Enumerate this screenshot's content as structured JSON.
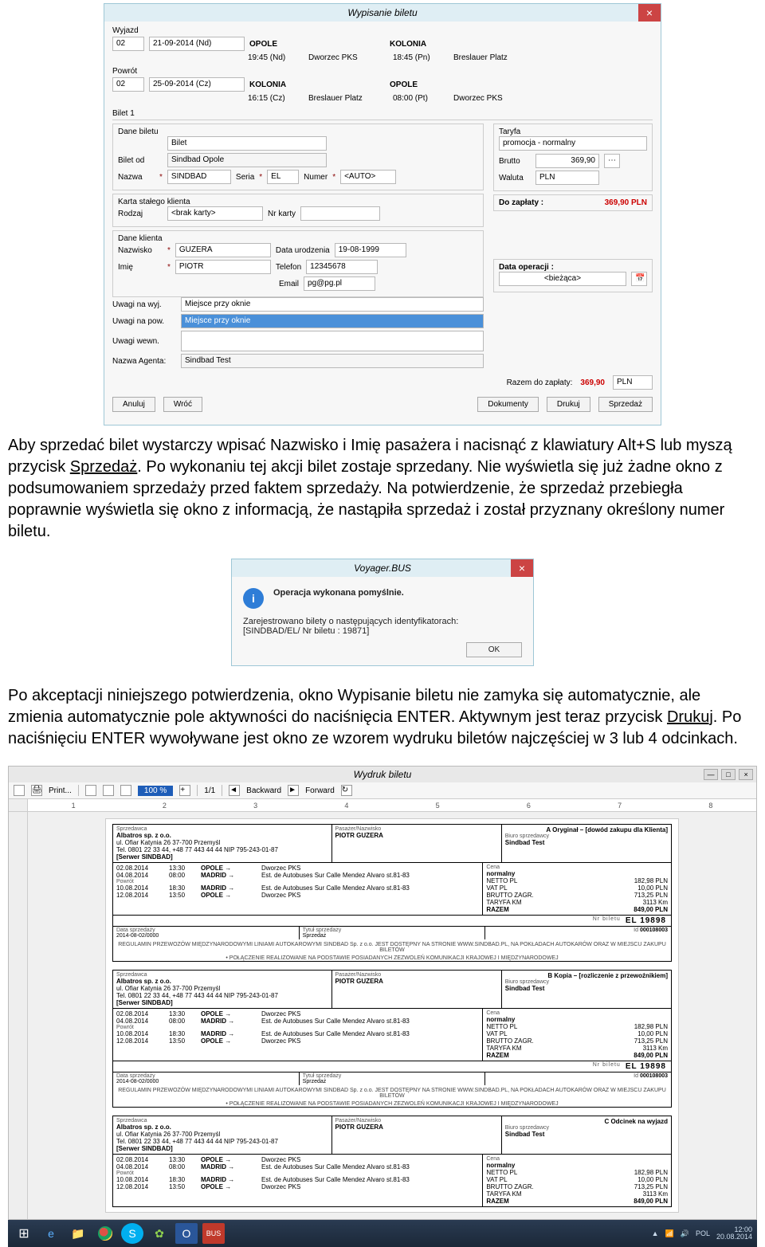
{
  "win1": {
    "title": "Wypisanie biletu",
    "wyjazd_label": "Wyjazd",
    "seg_no": "02",
    "out_date": "21-09-2014 (Nd)",
    "out_from": "OPOLE",
    "out_to": "KOLONIA",
    "out_time": "19:45 (Nd)",
    "out_station_from": "Dworzec PKS",
    "out_time2": "18:45 (Pn)",
    "out_station_to": "Breslauer Platz",
    "powrot_label": "Powrót",
    "ret_no": "02",
    "ret_date": "25-09-2014 (Cz)",
    "ret_from": "KOLONIA",
    "ret_to": "OPOLE",
    "ret_time": "16:15 (Cz)",
    "ret_station_from": "Breslauer Platz",
    "ret_time2": "08:00 (Pt)",
    "ret_station_to": "Dworzec PKS",
    "tab": "Bilet 1",
    "dane_biletu": "Dane biletu",
    "bilet_val": "Bilet",
    "biletod_label": "Bilet od",
    "biletod_val": "Sindbad Opole",
    "nazwa_label": "Nazwa",
    "nazwa_val": "SINDBAD",
    "seria_label": "Seria",
    "seria_val": "EL",
    "numer_label": "Numer",
    "numer_val": "<AUTO>",
    "taryfa_label": "Taryfa",
    "taryfa_val": "promocja - normalny",
    "brutto_label": "Brutto",
    "brutto_val": "369,90",
    "waluta_label": "Waluta",
    "waluta_val": "PLN",
    "dozaplaty_label": "Do zapłaty :",
    "dozaplaty_val": "369,90 PLN",
    "karta_label": "Karta stałego klienta",
    "rodzaj_label": "Rodzaj",
    "rodzaj_val": "<brak karty>",
    "nrkarty_label": "Nr karty",
    "daneklienta_label": "Dane klienta",
    "nazwisko_label": "Nazwisko",
    "nazwisko_val": "GUZERA",
    "dataur_label": "Data urodzenia",
    "dataur_val": "19-08-1999",
    "imie_label": "Imię",
    "imie_val": "PIOTR",
    "telefon_label": "Telefon",
    "telefon_val": "12345678",
    "email_label": "Email",
    "email_val": "pg@pg.pl",
    "dataop_label": "Data operacji :",
    "dataop_val": "<bieżąca>",
    "uwagi_wyj_label": "Uwagi na wyj.",
    "uwagi_wyj_val": "Miejsce przy oknie",
    "uwagi_pow_label": "Uwagi na pow.",
    "uwagi_pow_val": "Miejsce przy oknie",
    "uwagi_wewn_label": "Uwagi wewn.",
    "agent_label": "Nazwa Agenta:",
    "agent_val": "Sindbad Test",
    "razem_label": "Razem do zapłaty:",
    "razem_val": "369,90",
    "razem_cur": "PLN",
    "buttons": {
      "anuluj": "Anuluj",
      "wroc": "Wróć",
      "dokumenty": "Dokumenty",
      "drukuj": "Drukuj",
      "sprzedaz": "Sprzedaż"
    }
  },
  "para1": "Aby sprzedać bilet wystarczy wpisać Nazwisko i Imię pasażera i nacisnąć z klawiatury Alt+S lub myszą przycisk ",
  "para1_bold": "Sprzedaż",
  "para1b": ". Po wykonaniu tej akcji bilet zostaje sprzedany. Nie wyświetla się już żadne okno z podsumowaniem sprzedaży przed faktem sprzedaży. Na potwierdzenie, że sprzedaż przebiegła poprawnie wyświetla się okno z informacją, że nastąpiła sprzedaż i został przyznany określony numer biletu.",
  "dlg": {
    "title": "Voyager.BUS",
    "line1": "Operacja wykonana pomyślnie.",
    "line2": "Zarejestrowano bilety o następujących identyfikatorach:",
    "line3": "[SINDBAD/EL/ Nr biletu : 19871]",
    "ok": "OK"
  },
  "para2a": "Po akceptacji niniejszego potwierdzenia, okno Wypisanie biletu nie zamyka się automatycznie, ale zmienia automatycznie pole aktywności do naciśnięcia ENTER. Aktywnym jest teraz przycisk ",
  "para2_bold": "Drukuj",
  "para2b": ". Po naciśnięciu ENTER wywoływane jest okno ze wzorem wydruku biletów najczęściej w 3 lub 4 odcinkach.",
  "win3": {
    "title": "Wydruk biletu",
    "print": "Print...",
    "zoom": "100 %",
    "pages": "1/1",
    "backward": "Backward",
    "forward": "Forward",
    "rnums": [
      "1",
      "2",
      "3",
      "4",
      "5",
      "6",
      "7",
      "8"
    ],
    "tickets": [
      {
        "copy": "A Oryginał – [dowód zakupu dla Klienta]"
      },
      {
        "copy": "B Kopia – [rozliczenie z przewoźnikiem]"
      },
      {
        "copy": "C Odcinek na wyjazd"
      }
    ],
    "seller_hdr": "Sprzedawca",
    "seller1": "Albatros sp. z o.o.",
    "seller2": "ul. Ofiar Katynia 26 37-700 Przemyśl",
    "seller3": "Tel. 0801 22 33 44, +48 77 443 44 44 NIP 795-243-01-87",
    "seller4": "[Serwer SINDBAD]",
    "pass_hdr": "Pasażer/Nazwisko",
    "pass_name": "PIOTR GUZERA",
    "biuro_hdr": "Biuro sprzedawcy",
    "biuro_val": "Sindbad Test",
    "cena_hdr": "Cena",
    "cena_type": "normalny",
    "rows_labels": [
      "NETTO PL",
      "VAT PL",
      "BRUTTO ZAGR.",
      "TARYFA KM",
      "RAZEM"
    ],
    "rows_vals": [
      "182,98 PLN",
      "10,00 PLN",
      "713,25 PLN",
      "3113 Km",
      "849,00 PLN"
    ],
    "sched": [
      {
        "d": "02.08.2014",
        "t": "13:30",
        "c": "OPOLE →",
        "st": "Dworzec PKS"
      },
      {
        "d": "04.08.2014",
        "t": "08:00",
        "c": "MADRID →",
        "st": "Est. de Autobuses Sur Calle Mendez Alvaro st.81-83"
      },
      {
        "d": "",
        "t": "",
        "c": "",
        "st": ""
      },
      {
        "d": "10.08.2014",
        "t": "18:30",
        "c": "MADRID →",
        "st": "Est. de Autobuses Sur Calle Mendez Alvaro st.81-83"
      },
      {
        "d": "12.08.2014",
        "t": "13:50",
        "c": "OPOLE →",
        "st": "Dworzec PKS"
      }
    ],
    "powrot_pre": "Powrót",
    "nrbiletu_pre": "Nr biletu",
    "nrbiletu": "EL  19898",
    "datasp_lbl": "Data sprzedaży",
    "datasp_val": "2014-08-02/0000",
    "tyt_lbl": "Tytuł sprzedaży",
    "tyt_val": "Sprzedaż",
    "id_lbl": "Id",
    "id_val": "000108003",
    "regul": "REGULAMIN PRZEWOZÓW MIĘDZYNARODOWYMI LINIAMI AUTOKAROWYMI SINDBAD Sp. z o.o. JEST DOSTĘPNY NA STRONIE WWW.SINDBAD.PL, NA POKŁADACH AUTOKARÓW ORAZ W MIEJSCU ZAKUPU BILETÓW",
    "regul2": "• POŁĄCZENIE REALIZOWANE NA PODSTAWIE POSIADANYCH ZEZWOLEŃ KOMUNIKACJI KRAJOWEJ I MIĘDZYNARODOWEJ"
  },
  "tray": {
    "lang": "POL",
    "time": "12:00",
    "date": "20.08.2014"
  }
}
